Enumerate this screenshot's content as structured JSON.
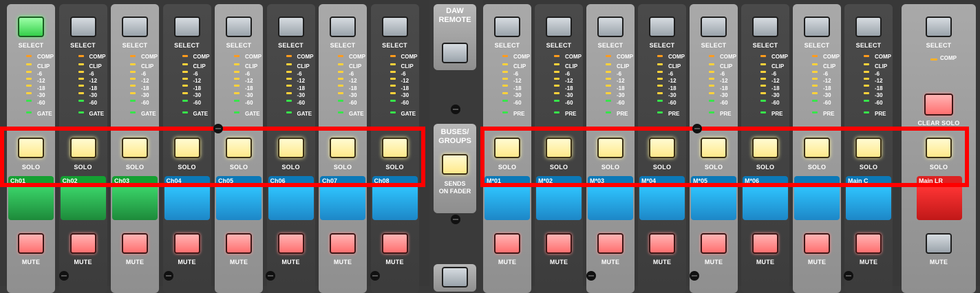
{
  "labels": {
    "select": "SELECT",
    "solo": "SOLO",
    "mute": "MUTE",
    "comp": "COMP",
    "gate": "GATE",
    "pre": "PRE",
    "clear_solo": "CLEAR SOLO"
  },
  "meter_scale": [
    "CLIP",
    "-6",
    "-12",
    "-18",
    "-30",
    "-60"
  ],
  "center": {
    "daw_line1": "DAW",
    "daw_line2": "REMOTE",
    "buses_line1": "BUSES/",
    "buses_line2": "GROUPS",
    "sends_line1": "SENDS",
    "sends_line2": "ON FADER"
  },
  "channels": [
    {
      "name": "Ch01",
      "color": "green",
      "select_lit": true,
      "meter_mode": "GATE"
    },
    {
      "name": "Ch02",
      "color": "green",
      "select_lit": false,
      "meter_mode": "GATE"
    },
    {
      "name": "Ch03",
      "color": "green",
      "select_lit": false,
      "meter_mode": "GATE"
    },
    {
      "name": "Ch04",
      "color": "blue",
      "select_lit": false,
      "meter_mode": "GATE"
    },
    {
      "name": "Ch05",
      "color": "blue",
      "select_lit": false,
      "meter_mode": "GATE"
    },
    {
      "name": "Ch06",
      "color": "blue",
      "select_lit": false,
      "meter_mode": "GATE"
    },
    {
      "name": "Ch07",
      "color": "blue",
      "select_lit": false,
      "meter_mode": "GATE"
    },
    {
      "name": "Ch08",
      "color": "blue",
      "select_lit": false,
      "meter_mode": "GATE"
    }
  ],
  "buses": [
    {
      "name": "M*01",
      "color": "blue",
      "meter_mode": "PRE"
    },
    {
      "name": "M*02",
      "color": "blue",
      "meter_mode": "PRE"
    },
    {
      "name": "M*03",
      "color": "blue",
      "meter_mode": "PRE"
    },
    {
      "name": "M*04",
      "color": "blue",
      "meter_mode": "PRE"
    },
    {
      "name": "M*05",
      "color": "blue",
      "meter_mode": "PRE"
    },
    {
      "name": "M*06",
      "color": "blue",
      "meter_mode": "PRE"
    },
    {
      "name": "",
      "color": "blue",
      "meter_mode": "PRE"
    },
    {
      "name": "Main C",
      "color": "blue",
      "meter_mode": "PRE"
    }
  ],
  "main": {
    "name": "Main LR",
    "color": "red"
  },
  "colors": {
    "highlight": "#ff0000"
  }
}
